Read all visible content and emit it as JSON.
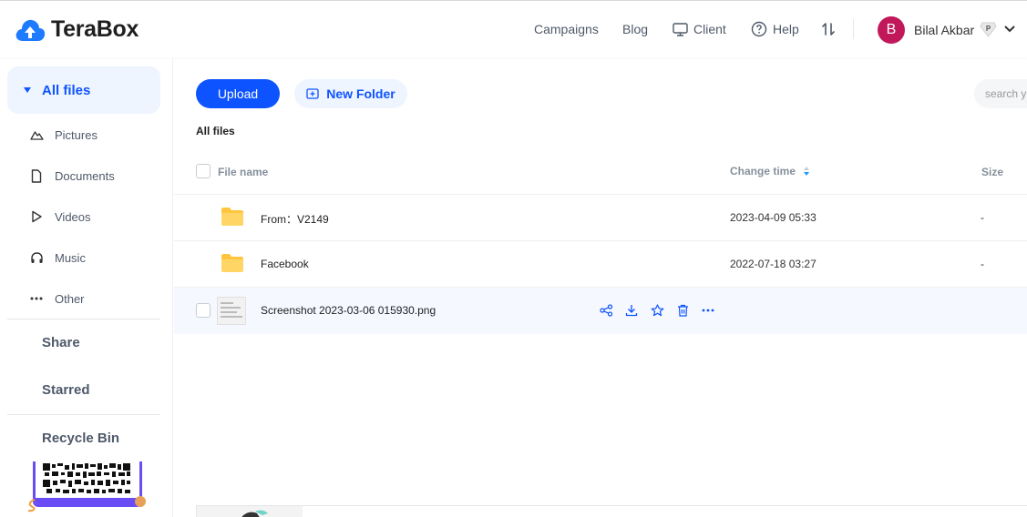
{
  "app": {
    "brand": "TeraBox",
    "accent": "#0d53ff"
  },
  "header": {
    "nav": [
      {
        "label": "Campaigns",
        "icon": ""
      },
      {
        "label": "Blog",
        "icon": ""
      },
      {
        "label": "Client",
        "icon": "monitor-icon"
      },
      {
        "label": "Help",
        "icon": "help-circle-icon"
      }
    ],
    "user": {
      "initial": "B",
      "name": "Bilal Akbar",
      "badge": "P"
    }
  },
  "sidebar": {
    "all_files": "All files",
    "categories": [
      {
        "label": "Pictures",
        "icon": "mountain-icon"
      },
      {
        "label": "Documents",
        "icon": "document-icon"
      },
      {
        "label": "Videos",
        "icon": "play-icon"
      },
      {
        "label": "Music",
        "icon": "headphones-icon"
      },
      {
        "label": "Other",
        "icon": "dots-icon"
      }
    ],
    "share": "Share",
    "starred": "Starred",
    "recycle_bin": "Recycle Bin"
  },
  "toolbar": {
    "upload": "Upload",
    "new_folder": "New Folder",
    "search_placeholder": "search y"
  },
  "breadcrumb": "All files",
  "table": {
    "headers": {
      "name": "File name",
      "time": "Change time",
      "size": "Size"
    },
    "rows": [
      {
        "name": "From：V2149",
        "time": "2023-04-09 05:33",
        "size": "-",
        "type": "folder"
      },
      {
        "name": "Facebook",
        "time": "2022-07-18 03:27",
        "size": "-",
        "type": "folder"
      },
      {
        "name": "Screenshot 2023-03-06 015930.png",
        "time": "",
        "size": "",
        "type": "image"
      }
    ]
  }
}
